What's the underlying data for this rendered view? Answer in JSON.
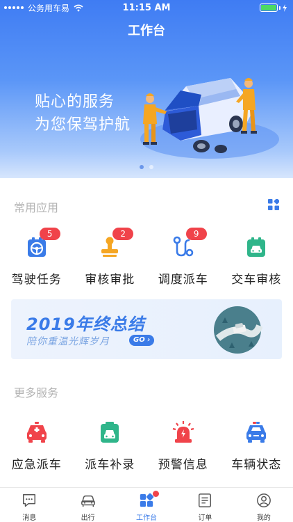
{
  "status_bar": {
    "carrier": "公务用车易",
    "time": "11:15 AM"
  },
  "header": {
    "title": "工作台"
  },
  "banner": {
    "line1": "贴心的服务",
    "line2": "为您保驾护航",
    "page_count": 2,
    "active_page": 1
  },
  "common_apps": {
    "title": "常用应用",
    "items": [
      {
        "label": "驾驶任务",
        "badge": "5",
        "icon": "steering-wheel-icon"
      },
      {
        "label": "审核审批",
        "badge": "2",
        "icon": "stamp-icon"
      },
      {
        "label": "调度派车",
        "badge": "9",
        "icon": "route-icon"
      },
      {
        "label": "交车审核",
        "badge": "",
        "icon": "car-clipboard-icon"
      }
    ]
  },
  "promo": {
    "title": "2019年终总结",
    "subtitle": "陪你重温光辉岁月",
    "cta": "GO"
  },
  "more_services": {
    "title": "更多服务",
    "items": [
      {
        "label": "应急派车",
        "icon": "ambulance-icon"
      },
      {
        "label": "派车补录",
        "icon": "car-record-icon"
      },
      {
        "label": "预警信息",
        "icon": "alarm-light-icon"
      },
      {
        "label": "车辆状态",
        "icon": "police-car-icon"
      }
    ]
  },
  "tabbar": {
    "items": [
      {
        "label": "消息",
        "icon": "message-icon"
      },
      {
        "label": "出行",
        "icon": "car-icon"
      },
      {
        "label": "工作台",
        "icon": "grid-icon",
        "active": true,
        "dot": true
      },
      {
        "label": "订单",
        "icon": "order-icon"
      },
      {
        "label": "我的",
        "icon": "user-icon"
      }
    ]
  },
  "colors": {
    "primary": "#3a7be8",
    "badge": "#f0434a",
    "teal": "#2fb58a",
    "orange": "#f5a623"
  }
}
